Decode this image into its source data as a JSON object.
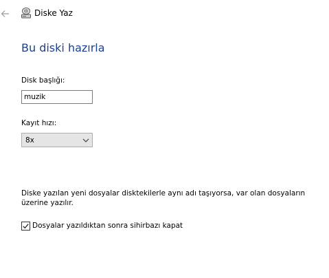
{
  "window": {
    "title": "Diske Yaz",
    "back_icon": "arrow-left-icon",
    "app_icon": "disc-drive-icon"
  },
  "page": {
    "heading": "Bu diski hazırla",
    "heading_color": "#1a3f8f"
  },
  "disc_title": {
    "label": "Disk başlığı:",
    "value": "muzik"
  },
  "write_speed": {
    "label": "Kayıt hızı:",
    "selected": "8x",
    "chevron_icon": "chevron-down-icon"
  },
  "info": {
    "text": "Diske yazılan yeni dosyalar disktekilerle aynı adı taşıyorsa, var olan dosyaların üzerine yazılır."
  },
  "close_wizard": {
    "label": "Dosyalar yazıldıktan sonra sihirbazı kapat",
    "checked": true
  }
}
